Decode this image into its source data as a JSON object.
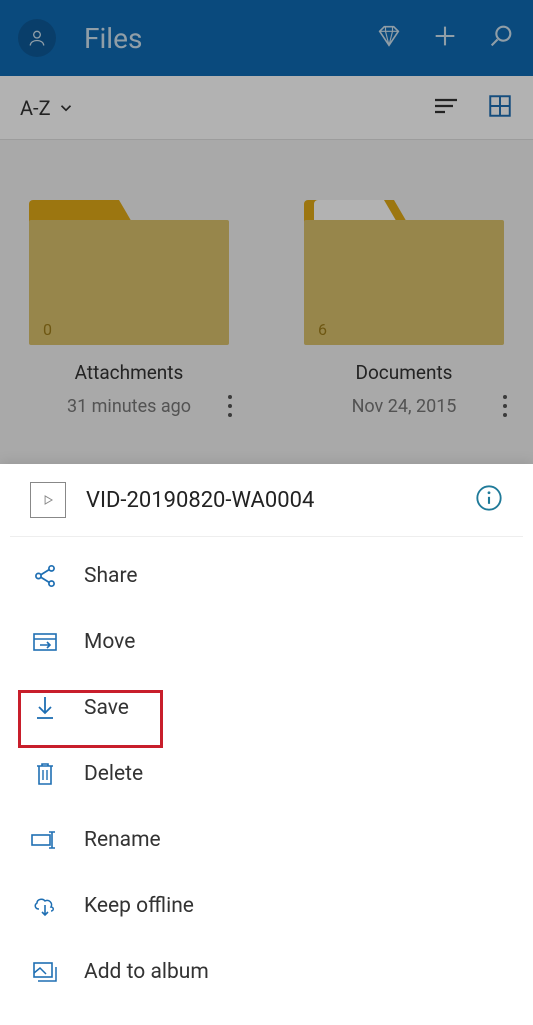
{
  "header": {
    "title": "Files"
  },
  "sortbar": {
    "sort_label": "A-Z"
  },
  "folders": [
    {
      "name": "Attachments",
      "date": "31 minutes ago",
      "count": "0"
    },
    {
      "name": "Documents",
      "date": "Nov 24, 2015",
      "count": "6"
    }
  ],
  "sheet": {
    "title": "VID-20190820-WA0004",
    "items": {
      "share": "Share",
      "move": "Move",
      "save": "Save",
      "delete": "Delete",
      "rename": "Rename",
      "keep_offline": "Keep offline",
      "add_to_album": "Add to album"
    }
  }
}
